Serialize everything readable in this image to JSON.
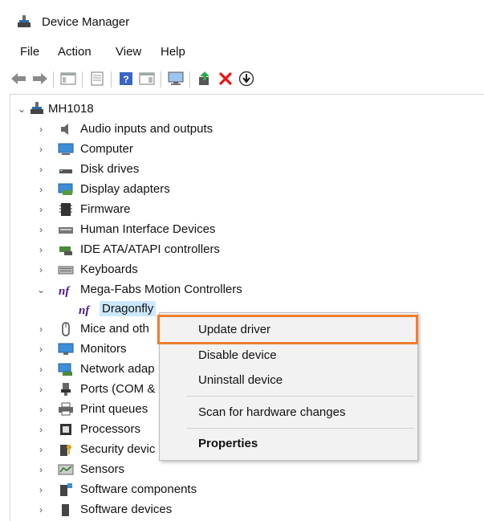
{
  "window": {
    "title": "Device Manager"
  },
  "menu": [
    "File",
    "Action",
    "View",
    "Help"
  ],
  "toolbar": {
    "icons": [
      "back-arrow-icon",
      "forward-arrow-icon",
      "show-hide-console-tree-icon",
      "properties-icon",
      "help-icon",
      "action-pane-icon",
      "monitor-icon",
      "update-driver-icon",
      "uninstall-x-icon",
      "download-circle-icon"
    ]
  },
  "tree": {
    "root": "MH1018",
    "items": [
      {
        "label": "Audio inputs and outputs"
      },
      {
        "label": "Computer"
      },
      {
        "label": "Disk drives"
      },
      {
        "label": "Display adapters"
      },
      {
        "label": "Firmware"
      },
      {
        "label": "Human Interface Devices"
      },
      {
        "label": "IDE ATA/ATAPI controllers"
      },
      {
        "label": "Keyboards"
      },
      {
        "label": "Mega-Fabs Motion Controllers"
      },
      {
        "label": "Dragonfly"
      },
      {
        "label": "Mice and oth"
      },
      {
        "label": "Monitors"
      },
      {
        "label": "Network adap"
      },
      {
        "label": "Ports (COM &"
      },
      {
        "label": "Print queues"
      },
      {
        "label": "Processors"
      },
      {
        "label": "Security devic"
      },
      {
        "label": "Sensors"
      },
      {
        "label": "Software components"
      },
      {
        "label": "Software devices"
      }
    ]
  },
  "context_menu": {
    "update": "Update driver",
    "disable": "Disable device",
    "uninstall": "Uninstall device",
    "scan": "Scan for hardware changes",
    "properties": "Properties"
  },
  "colors": {
    "highlight": "#ef7d2d"
  }
}
